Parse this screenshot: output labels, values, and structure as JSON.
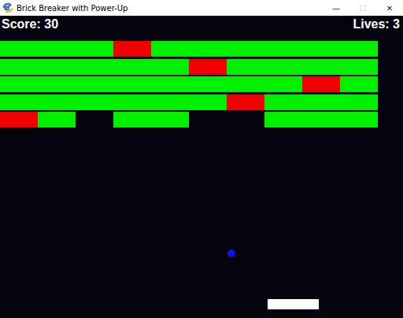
{
  "window": {
    "title": "Brick Breaker with Power-Up",
    "controls": [
      {
        "glyph": "—",
        "disabled": false
      },
      {
        "glyph": "☐",
        "disabled": true
      },
      {
        "glyph": "✕",
        "disabled": false
      }
    ]
  },
  "hud": {
    "score": "Score: 30",
    "lives": "Lives: 3"
  },
  "bricks": [
    [
      {
        "present": true,
        "color": "#00f000"
      },
      {
        "present": true,
        "color": "#00f000"
      },
      {
        "present": true,
        "color": "#00f000"
      },
      {
        "present": true,
        "color": "#f00000"
      },
      {
        "present": true,
        "color": "#00f000"
      },
      {
        "present": true,
        "color": "#00f000"
      },
      {
        "present": true,
        "color": "#00f000"
      },
      {
        "present": true,
        "color": "#00f000"
      },
      {
        "present": true,
        "color": "#00f000"
      },
      {
        "present": true,
        "color": "#00f000"
      }
    ],
    [
      {
        "present": true,
        "color": "#00f000"
      },
      {
        "present": true,
        "color": "#00f000"
      },
      {
        "present": true,
        "color": "#00f000"
      },
      {
        "present": true,
        "color": "#00f000"
      },
      {
        "present": true,
        "color": "#00f000"
      },
      {
        "present": true,
        "color": "#f00000"
      },
      {
        "present": true,
        "color": "#00f000"
      },
      {
        "present": true,
        "color": "#00f000"
      },
      {
        "present": true,
        "color": "#00f000"
      },
      {
        "present": true,
        "color": "#00f000"
      }
    ],
    [
      {
        "present": true,
        "color": "#00f000"
      },
      {
        "present": true,
        "color": "#00f000"
      },
      {
        "present": true,
        "color": "#00f000"
      },
      {
        "present": true,
        "color": "#00f000"
      },
      {
        "present": true,
        "color": "#00f000"
      },
      {
        "present": true,
        "color": "#00f000"
      },
      {
        "present": true,
        "color": "#00f000"
      },
      {
        "present": true,
        "color": "#00f000"
      },
      {
        "present": true,
        "color": "#f00000"
      },
      {
        "present": true,
        "color": "#00f000"
      }
    ],
    [
      {
        "present": true,
        "color": "#00f000"
      },
      {
        "present": true,
        "color": "#00f000"
      },
      {
        "present": true,
        "color": "#00f000"
      },
      {
        "present": true,
        "color": "#00f000"
      },
      {
        "present": true,
        "color": "#00f000"
      },
      {
        "present": true,
        "color": "#00f000"
      },
      {
        "present": true,
        "color": "#f00000"
      },
      {
        "present": true,
        "color": "#00f000"
      },
      {
        "present": true,
        "color": "#00f000"
      },
      {
        "present": true,
        "color": "#00f000"
      }
    ],
    [
      {
        "present": true,
        "color": "#f00000"
      },
      {
        "present": true,
        "color": "#00f000"
      },
      {
        "present": false,
        "color": "#00f000"
      },
      {
        "present": true,
        "color": "#00f000"
      },
      {
        "present": true,
        "color": "#00f000"
      },
      {
        "present": false,
        "color": "#00f000"
      },
      {
        "present": false,
        "color": "#00f000"
      },
      {
        "present": true,
        "color": "#00f000"
      },
      {
        "present": true,
        "color": "#00f000"
      },
      {
        "present": true,
        "color": "#00f000"
      }
    ]
  ]
}
